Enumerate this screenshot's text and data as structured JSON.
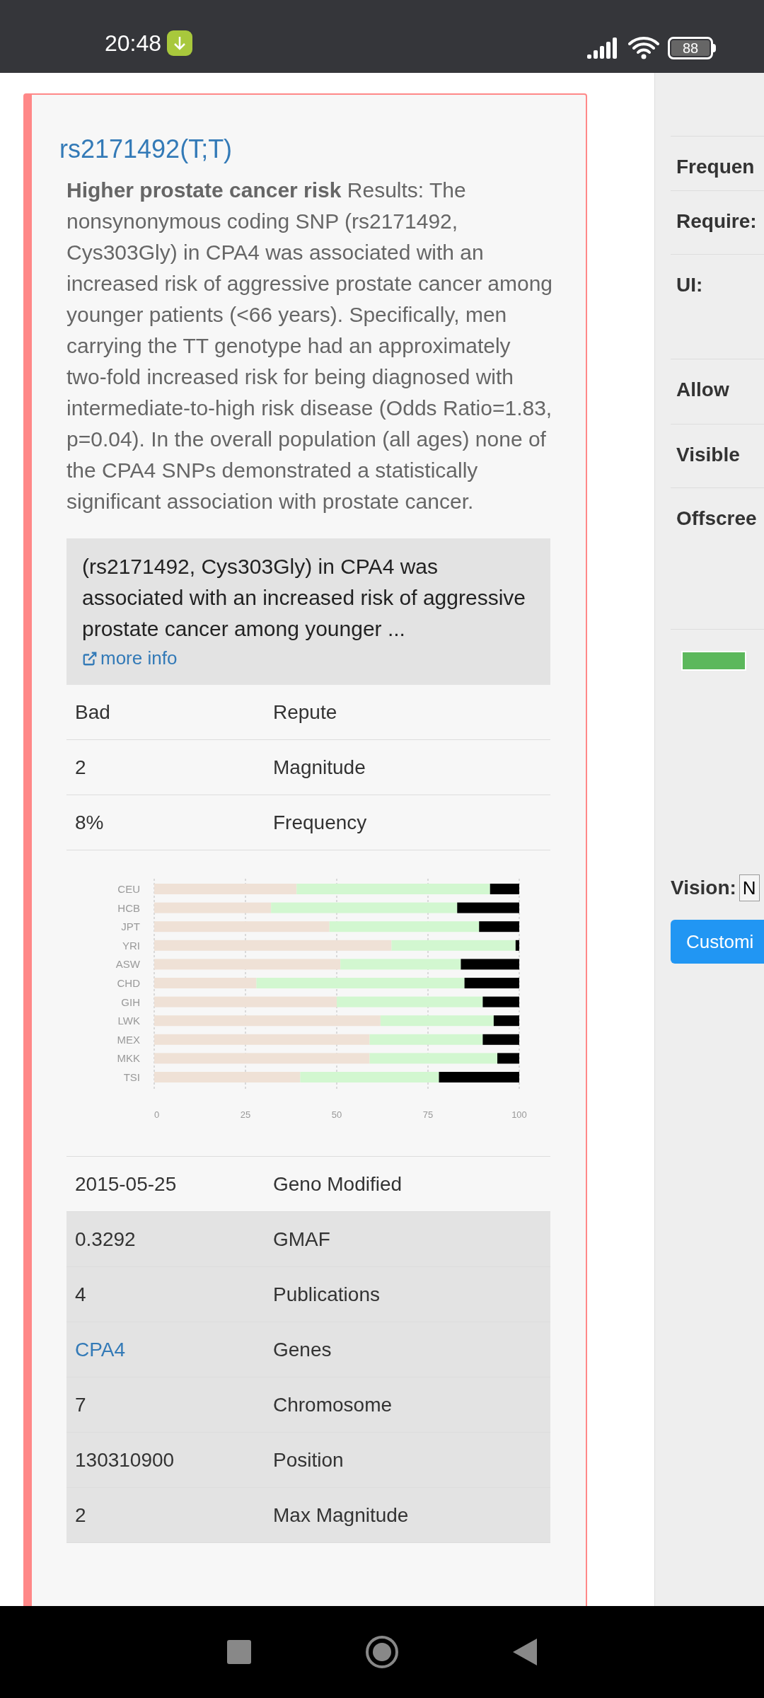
{
  "status_bar": {
    "time": "20:48",
    "battery": "88"
  },
  "card": {
    "title": "rs2171492(T;T)",
    "summary": "**Higher prostate cancer risk** Results: The nonsynonymous coding SNP (rs2171492, Cys303Gly) in CPA4 was associated with an increased risk of aggressive prostate cancer among younger patients (<66 years). Specifically, men carrying the TT genotype had an approximately two-fold increased risk for being diagnosed with intermediate-to-high risk disease (Odds Ratio=1.83, p=0.04). In the overall population (all ages) none of the CPA4 SNPs demonstrated a statistically significant association with prostate cancer.",
    "excerpt": {
      "text": "(rs2171492, Cys303Gly) in CPA4 was associated with an increased risk of aggressive prostate cancer among younger ...",
      "link": "more info"
    },
    "top_rows": [
      {
        "value": "Bad",
        "label": "Repute"
      },
      {
        "value": "2",
        "label": "Magnitude"
      },
      {
        "value": "8%",
        "label": "Frequency"
      }
    ],
    "chart_data": {
      "type": "bar",
      "orientation": "horizontal",
      "stacked": true,
      "categories": [
        "CEU",
        "HCB",
        "JPT",
        "YRI",
        "ASW",
        "CHD",
        "GIH",
        "LWK",
        "MEX",
        "MKK",
        "TSI"
      ],
      "series": [
        {
          "color": "#efe1d6",
          "values": [
            39,
            32,
            48,
            65,
            51,
            28,
            50,
            62,
            59,
            59,
            40
          ]
        },
        {
          "color": "#d2f7d0",
          "values": [
            53,
            51,
            41,
            34,
            33,
            57,
            40,
            31,
            31,
            35,
            38
          ]
        },
        {
          "color": "#000000",
          "values": [
            8,
            17,
            11,
            1,
            16,
            15,
            10,
            7,
            10,
            6,
            22
          ]
        }
      ],
      "xlim": [
        0,
        100
      ],
      "xticks": [
        0,
        25,
        50,
        75,
        100
      ],
      "grid": true
    },
    "geno_rows": [
      {
        "value": "2015-05-25",
        "label": "Geno Modified",
        "kind": "text"
      }
    ],
    "snp_rows": [
      {
        "value": "0.3292",
        "label": "GMAF",
        "kind": "text"
      },
      {
        "value": "4",
        "label": "Publications",
        "kind": "text"
      },
      {
        "value": "CPA4",
        "label": "Genes",
        "kind": "link"
      },
      {
        "value": "7",
        "label": "Chromosome",
        "kind": "text"
      },
      {
        "value": "130310900",
        "label": "Position",
        "kind": "text"
      },
      {
        "value": "2",
        "label": "Max Magnitude",
        "kind": "text"
      }
    ]
  },
  "side_panel": {
    "rows": [
      {
        "label": "Frequen"
      },
      {
        "label": "Require:"
      },
      {
        "label": "UI:"
      },
      {
        "label": "Allow"
      },
      {
        "label": "Visible"
      },
      {
        "label": "Offscree"
      }
    ],
    "vision_label": "Vision:",
    "vision_value": "N",
    "button": "Customi"
  }
}
